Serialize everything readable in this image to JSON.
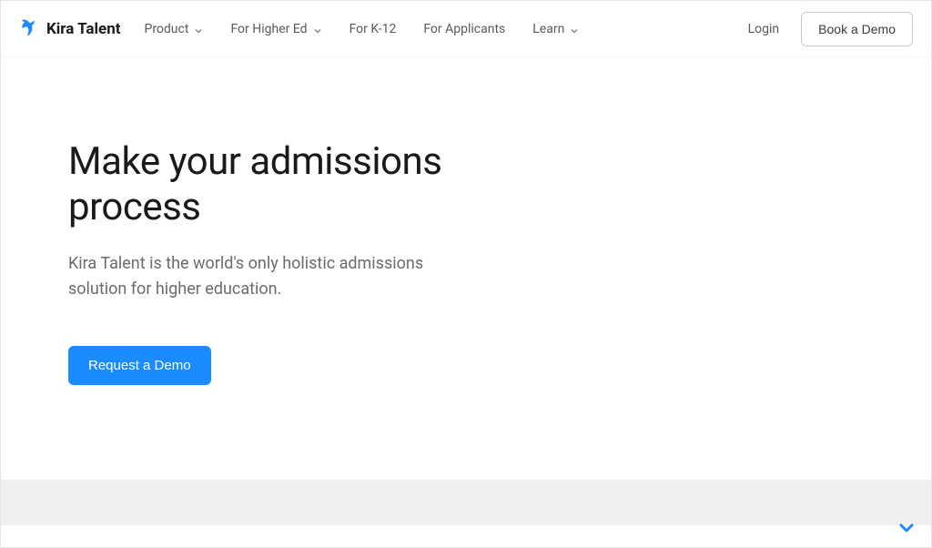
{
  "header": {
    "brand_name": "Kira Talent",
    "nav": [
      {
        "label": "Product",
        "has_dropdown": true
      },
      {
        "label": "For Higher Ed",
        "has_dropdown": true
      },
      {
        "label": "For K-12",
        "has_dropdown": false
      },
      {
        "label": "For Applicants",
        "has_dropdown": false
      },
      {
        "label": "Learn",
        "has_dropdown": true
      }
    ],
    "login_label": "Login",
    "cta_label": "Book a Demo"
  },
  "hero": {
    "title": "Make your admissions process",
    "subtitle": "Kira Talent is the world's only holistic admissions solution for higher education.",
    "cta_label": "Request a Demo"
  }
}
